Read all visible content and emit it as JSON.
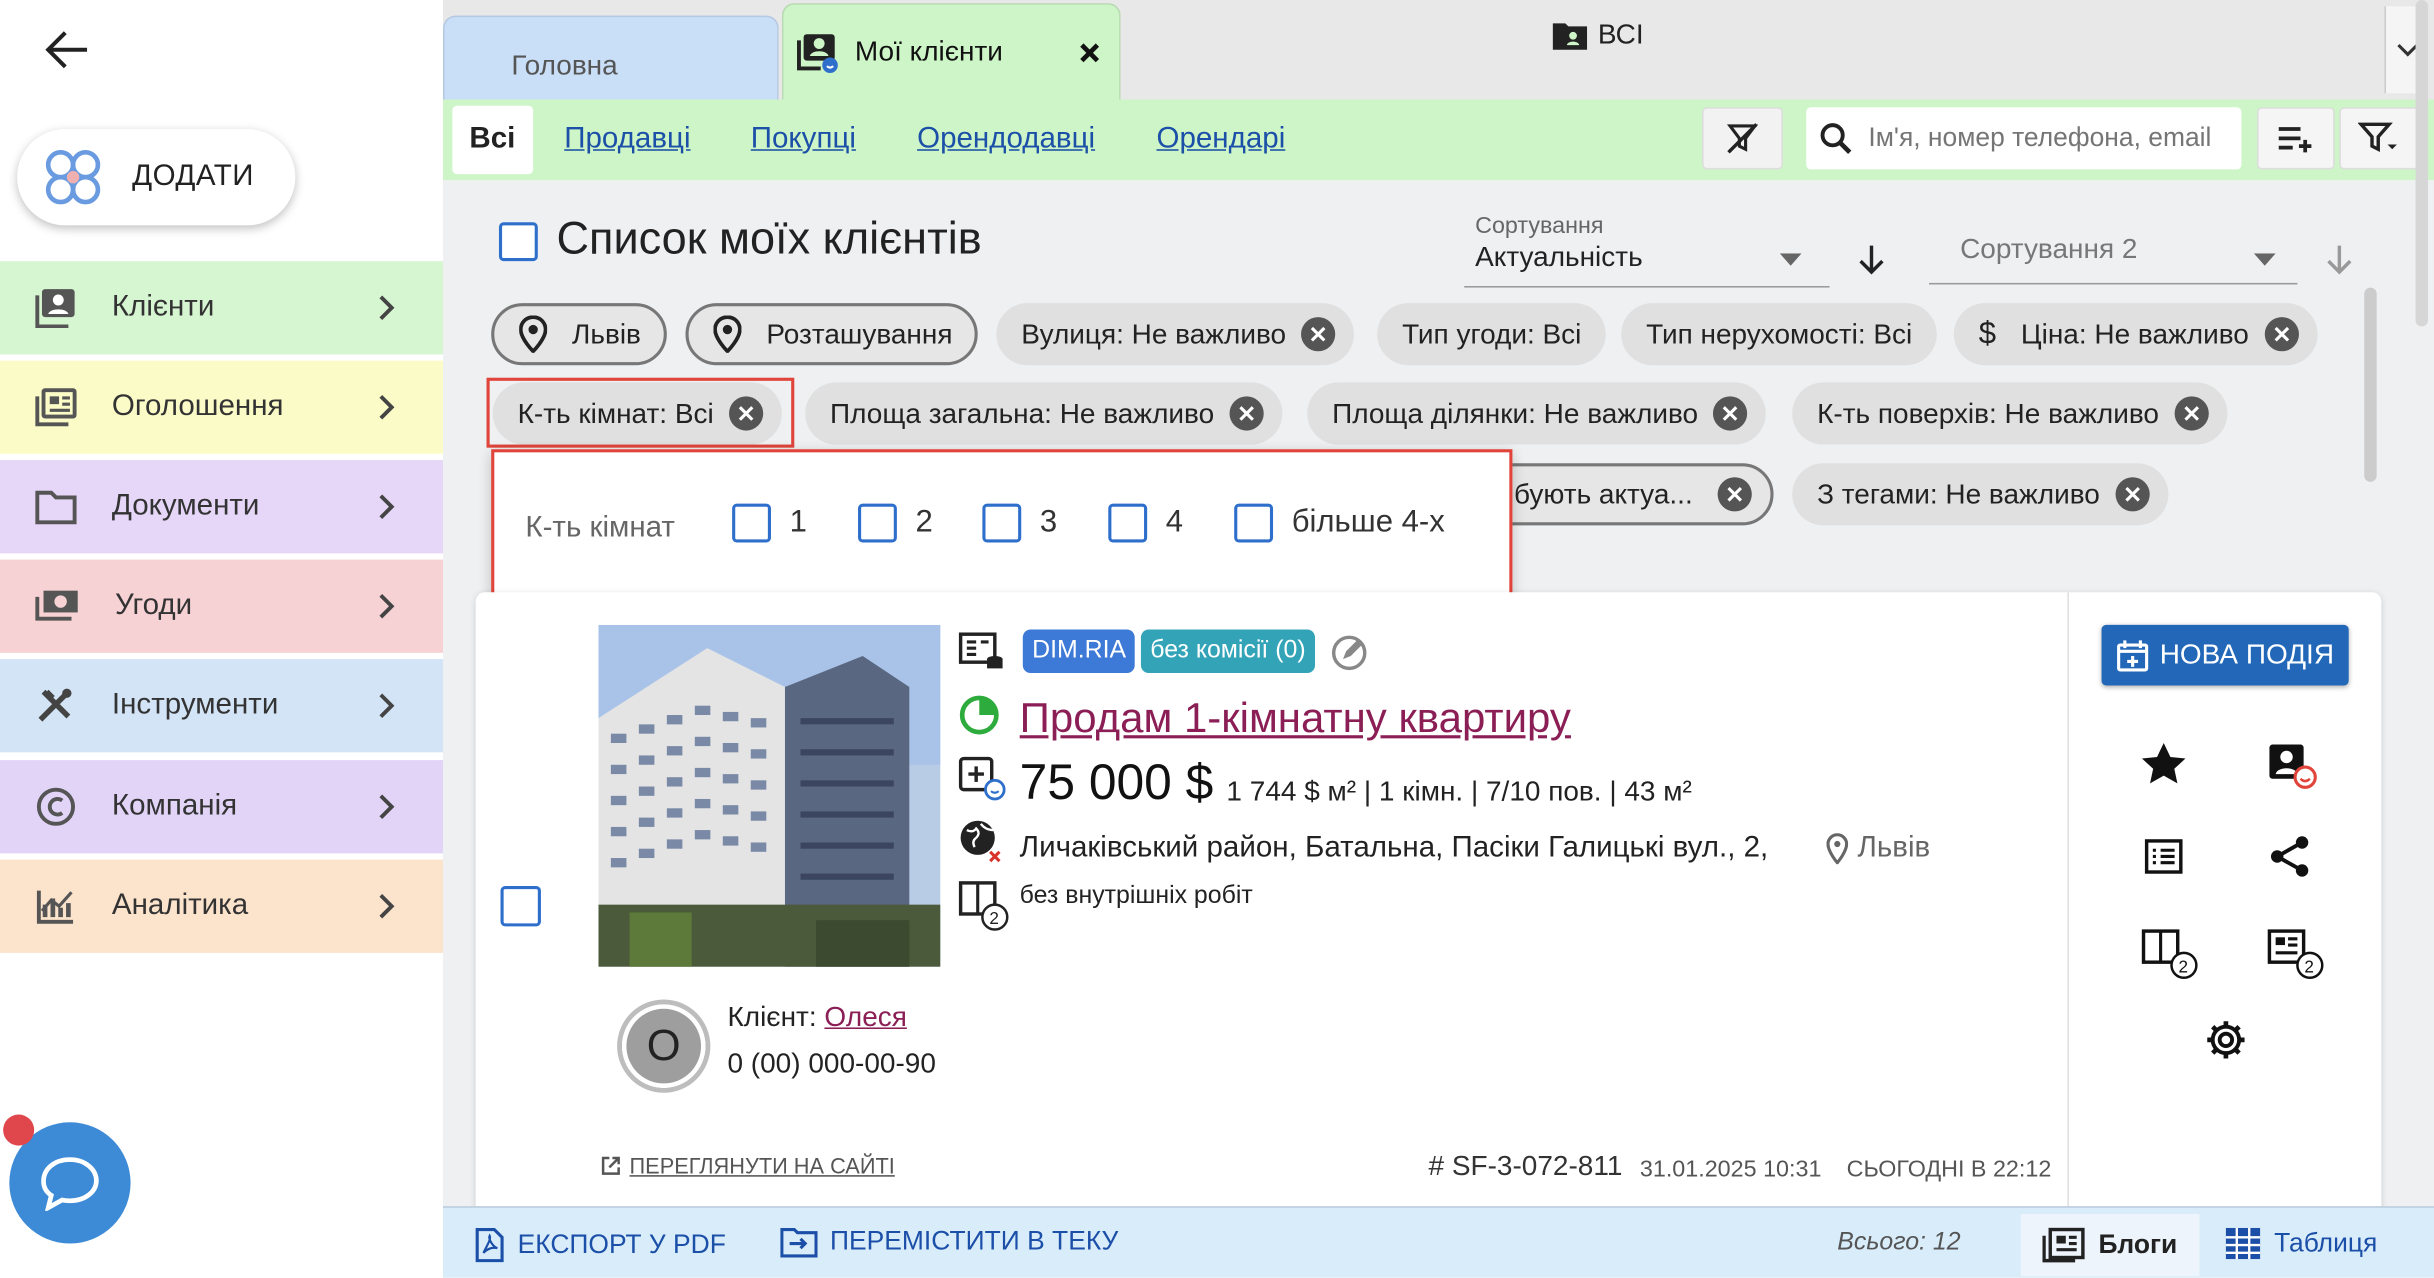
{
  "sidebar": {
    "add_label": "ДОДАТИ",
    "items": [
      {
        "label": "Клієнти",
        "color": "#d6f5d1",
        "icon": "clients-icon"
      },
      {
        "label": "Оголошення",
        "color": "#fbfbc8",
        "icon": "listings-icon"
      },
      {
        "label": "Документи",
        "color": "#e6d6f7",
        "icon": "folder-icon"
      },
      {
        "label": "Угоди",
        "color": "#f7d2d4",
        "icon": "deals-icon"
      },
      {
        "label": "Інструменти",
        "color": "#d4e4f7",
        "icon": "tools-icon"
      },
      {
        "label": "Компанія",
        "color": "#e2d4f7",
        "icon": "copyright-icon"
      },
      {
        "label": "Аналітика",
        "color": "#fbe3cc",
        "icon": "analytics-icon"
      }
    ]
  },
  "tabs": {
    "home": "Головна",
    "my_clients": "Мої клієнти"
  },
  "filterbar": {
    "tabs": [
      "Всі",
      "Продавці",
      "Покупці",
      "Орендодавці",
      "Орендарі"
    ],
    "folder_label": "ВСІ",
    "search_placeholder": "Ім'я, номер телефона, email"
  },
  "list": {
    "title": "Список моїх клієнтів",
    "sort1_label": "Сортування",
    "sort1_value": "Актуальність",
    "sort2_label": "Сортування 2"
  },
  "chips": {
    "city": "Львів",
    "location": "Розташування",
    "street": "Вулиця: Не важливо",
    "deal_type": "Тип угоди: Всі",
    "property_type": "Тип нерухомості: Всі",
    "price": "Ціна: Не важливо",
    "rooms": "К-ть кімнат: Всі",
    "area_total": "Площа загальна: Не важливо",
    "area_land": "Площа ділянки: Не важливо",
    "floors": "К-ть поверхів: Не важливо",
    "actual": "бують актуа...",
    "tags": "З тегами: Не важливо"
  },
  "rooms_popup": {
    "label": "К-ть кімнат",
    "options": [
      "1",
      "2",
      "3",
      "4",
      "більше 4-х"
    ]
  },
  "listing": {
    "badge_source": "DIM.RIA",
    "badge_commission": "без комісії (0)",
    "title": "Продам 1-кімнатну квартиру",
    "price": "75 000 $",
    "details": "1 744 $ м² | 1 кімн. | 7/10 пов. | 43 м²",
    "address": "Личаківський район, Батальна, Пасіки Галицькі вул., 2,",
    "city": "Львів",
    "condition": "без внутрішніх робіт",
    "client_label": "Клієнт:",
    "client_name": "Олеся",
    "phone": "0 (00) 000-00-90",
    "avatar_letter": "О",
    "view_on_site": "ПЕРЕГЛЯНУТИ НА САЙТІ",
    "id": "# SF-3-072-811",
    "created": "31.01.2025 10:31",
    "updated": "СЬОГОДНІ В 22:12",
    "new_event": "НОВА ПОДІЯ",
    "badge_count": "2"
  },
  "bottombar": {
    "export_pdf": "ЕКСПОРТ У PDF",
    "move_folder": "ПЕРЕМІСТИТИ В ТЕКУ",
    "total": "Всього: 12",
    "blogs": "Блоги",
    "table": "Таблиця"
  }
}
